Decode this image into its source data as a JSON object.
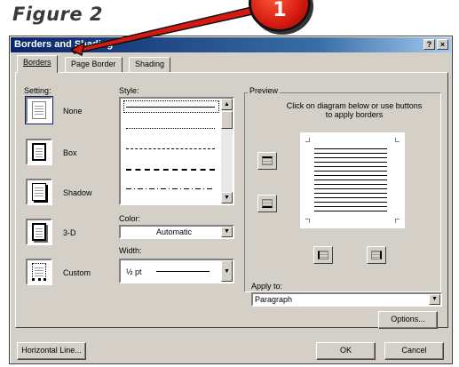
{
  "figure_label": "Figure 2",
  "callout_number": "1",
  "window": {
    "title": "Borders and Shading",
    "help_btn": "?",
    "close_btn": "×"
  },
  "tabs": [
    {
      "label": "Borders",
      "active": true
    },
    {
      "label": "Page Border",
      "active": false
    },
    {
      "label": "Shading",
      "active": false
    }
  ],
  "setting": {
    "label": "Setting:",
    "options": [
      {
        "label": "None",
        "icon": "none-border-icon",
        "selected": true
      },
      {
        "label": "Box",
        "icon": "box-border-icon"
      },
      {
        "label": "Shadow",
        "icon": "shadow-border-icon"
      },
      {
        "label": "3-D",
        "icon": "3d-border-icon"
      },
      {
        "label": "Custom",
        "icon": "custom-border-icon"
      }
    ]
  },
  "style": {
    "label": "Style:"
  },
  "color": {
    "label": "Color:",
    "value": "Automatic"
  },
  "width": {
    "label": "Width:",
    "value": "½ pt"
  },
  "preview": {
    "label": "Preview",
    "instructions": "Click on diagram below or use buttons to apply borders"
  },
  "apply_to": {
    "label": "Apply to:",
    "value": "Paragraph"
  },
  "buttons": {
    "options": "Options...",
    "horizontal_line": "Horizontal Line...",
    "ok": "OK",
    "cancel": "Cancel"
  },
  "colors": {
    "title_start": "#0a246a",
    "dialog_bg": "#d4d0c8",
    "callout_red": "#d41a10"
  }
}
